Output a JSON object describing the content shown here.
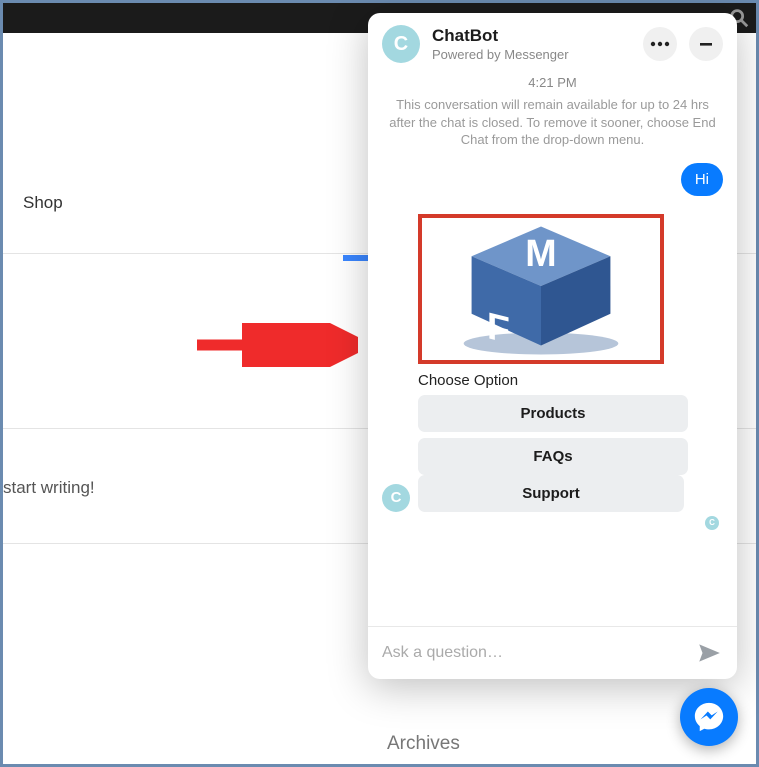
{
  "page": {
    "shop_heading": "Shop",
    "start_writing": "start writing!",
    "archives": "Archives"
  },
  "chat": {
    "header": {
      "avatar_letter": "C",
      "title": "ChatBot",
      "subtitle": "Powered by Messenger"
    },
    "timestamp": "4:21 PM",
    "system_message": "This conversation will remain available for up to 24 hrs after the chat is closed. To remove it sooner, choose End Chat from the drop-down menu.",
    "user_message": "Hi",
    "bot": {
      "avatar_letter": "C",
      "image_label": "FME",
      "choose_label": "Choose Option",
      "options": [
        "Products",
        "FAQs",
        "Support"
      ]
    },
    "input_placeholder": "Ask a question…"
  }
}
